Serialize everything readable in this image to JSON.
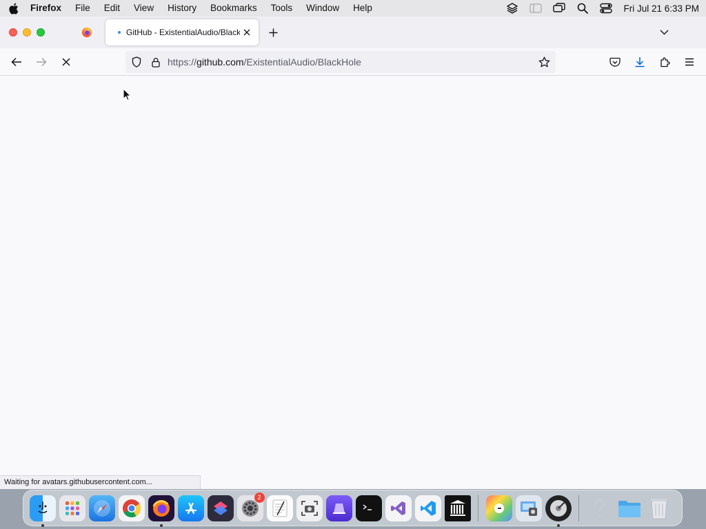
{
  "menubar": {
    "app_name": "Firefox",
    "items": [
      "File",
      "Edit",
      "View",
      "History",
      "Bookmarks",
      "Tools",
      "Window",
      "Help"
    ],
    "clock": "Fri Jul 21  6:33 PM"
  },
  "tabs": {
    "active_title": "GitHub - ExistentialAudio/BlackHole"
  },
  "urlbar": {
    "url_prefix": "https://",
    "url_host": "github.com",
    "url_path": "/ExistentialAudio/BlackHole"
  },
  "status": {
    "text": "Waiting for avatars.githubusercontent.com..."
  },
  "dock": {
    "settings_badge": "2"
  }
}
